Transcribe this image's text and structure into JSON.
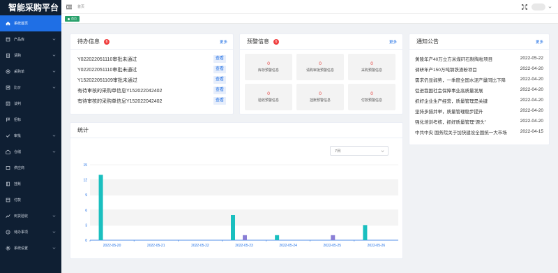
{
  "app": {
    "title": "智能采购平台"
  },
  "sidebar": {
    "items": [
      {
        "label": "系统首页",
        "icon": "home-icon",
        "active": true,
        "submenu": false
      },
      {
        "label": "产品库",
        "icon": "box-icon",
        "active": false,
        "submenu": true
      },
      {
        "label": "请购",
        "icon": "clipboard-icon",
        "active": false,
        "submenu": true
      },
      {
        "label": "采购单",
        "icon": "cart-icon",
        "active": false,
        "submenu": true
      },
      {
        "label": "比价",
        "icon": "compare-icon",
        "active": false,
        "submenu": true
      },
      {
        "label": "谈判",
        "icon": "chat-icon",
        "active": false,
        "submenu": false
      },
      {
        "label": "招标",
        "icon": "flag-icon",
        "active": false,
        "submenu": false
      },
      {
        "label": "审批",
        "icon": "check-icon",
        "active": false,
        "submenu": true
      },
      {
        "label": "仓储",
        "icon": "warehouse-icon",
        "active": false,
        "submenu": true
      },
      {
        "label": "供应商",
        "icon": "supplier-icon",
        "active": false,
        "submenu": false
      },
      {
        "label": "挂账",
        "icon": "ledger-icon",
        "active": false,
        "submenu": false
      },
      {
        "label": "付款",
        "icon": "payment-icon",
        "active": false,
        "submenu": false
      },
      {
        "label": "到货验收",
        "icon": "chart-line-icon",
        "active": false,
        "submenu": true
      },
      {
        "label": "待办事项",
        "icon": "todo-icon",
        "active": false,
        "submenu": true
      },
      {
        "label": "系统设置",
        "icon": "gear-icon",
        "active": false,
        "submenu": true
      }
    ]
  },
  "header": {
    "breadcrumb": "首页"
  },
  "tabs": [
    {
      "label": "首页"
    }
  ],
  "todo": {
    "title": "待办信息",
    "badge": "6",
    "more": "更多",
    "view_label": "查看",
    "rows": [
      "Y022022051110审批未通过",
      "Y022022051110审批未通过",
      "Y152022051109审批未通过",
      "有待审核的采购单信息Y152022042402",
      "有待审核的采购单信息Y152022042402"
    ]
  },
  "warning": {
    "title": "预警信息",
    "badge": "6",
    "more": "更多",
    "cells": [
      {
        "value": "0",
        "label": "库存预警信息"
      },
      {
        "value": "0",
        "label": "请购审批预警信息"
      },
      {
        "value": "0",
        "label": "采购预警信息"
      },
      {
        "value": "0",
        "label": "验收预警信息"
      },
      {
        "value": "0",
        "label": "挂账预警信息"
      },
      {
        "value": "0",
        "label": "付款预警信息"
      }
    ]
  },
  "notice": {
    "title": "通知公告",
    "more": "更多",
    "rows": [
      {
        "title": "黄陵年产40万立方米煤矸石制陶粒项目",
        "date": "2022-05-22"
      },
      {
        "title": "调研年产150万吨钢铁渣粉项目",
        "date": "2022-04-20"
      },
      {
        "title": "需求仍显弱势，一季度全国水泥产量同比下降",
        "date": "2022-04-20"
      },
      {
        "title": "促进我国社会保障事业高质量发展",
        "date": "2022-04-20"
      },
      {
        "title": "抓好企业生产经营，质量管理是关键",
        "date": "2022-04-20"
      },
      {
        "title": "坚持多措并举，质量管理稳步提升",
        "date": "2022-04-20"
      },
      {
        "title": "强化培训考核，抓好质量管理“源头”",
        "date": "2022-04-20"
      },
      {
        "title": "中共中央 国务院关于加快建设全国统一大市场",
        "date": "2022-04-15"
      }
    ]
  },
  "stats": {
    "title": "统计",
    "range_select": "7日"
  },
  "chart_data": {
    "type": "bar",
    "categories": [
      "2022-05-20",
      "2022-05-21",
      "2022-05-22",
      "2022-05-23",
      "2022-05-24",
      "2022-05-25",
      "2022-05-26"
    ],
    "series": [
      {
        "values": [
          13,
          0,
          0,
          5,
          1,
          0,
          3
        ],
        "color": "#1abfbf"
      },
      {
        "values": [
          0,
          0,
          0,
          1,
          0,
          1,
          0
        ],
        "color": "#8a7fd6"
      }
    ],
    "yticks": [
      0,
      3,
      6,
      9,
      12,
      15
    ],
    "ylim": [
      0,
      15
    ],
    "grid": true
  },
  "colors": {
    "sidebar_bg": "#0f1f33",
    "active": "#1f6fe5",
    "tab": "#27a06a",
    "badge": "#f04040",
    "warn_value": "#e53935"
  }
}
